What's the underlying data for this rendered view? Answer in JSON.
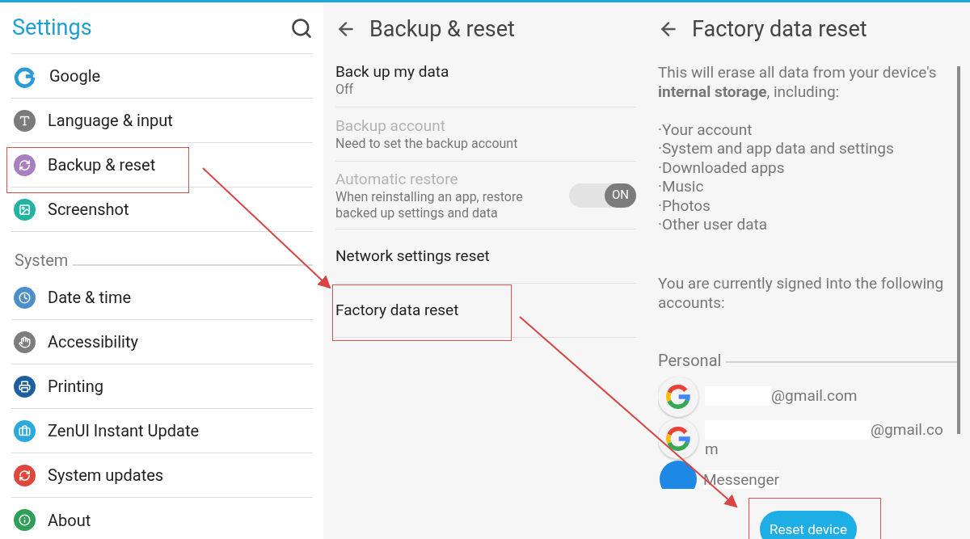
{
  "settings": {
    "title": "Settings",
    "sections": [
      {
        "items": [
          {
            "label": "Google"
          },
          {
            "label": "Language & input"
          },
          {
            "label": "Backup & reset"
          },
          {
            "label": "Screenshot"
          }
        ]
      },
      {
        "header": "System",
        "items": [
          {
            "label": "Date & time"
          },
          {
            "label": "Accessibility"
          },
          {
            "label": "Printing"
          },
          {
            "label": "ZenUI Instant Update"
          },
          {
            "label": "System updates"
          },
          {
            "label": "About"
          }
        ]
      }
    ]
  },
  "backup_reset": {
    "title": "Backup & reset",
    "items": [
      {
        "kind": "text",
        "title": "Back up my data",
        "subtitle": "Off",
        "disabled": false
      },
      {
        "kind": "text",
        "title": "Backup account",
        "subtitle": "Need to set the backup account",
        "disabled": true
      },
      {
        "kind": "toggle",
        "title": "Automatic restore",
        "subtitle": "When reinstalling an app, restore backed up settings and data",
        "disabled": true,
        "toggle_label": "ON",
        "on": true
      },
      {
        "kind": "text",
        "title": "Network settings reset",
        "disabled": false
      },
      {
        "kind": "text",
        "title": "Factory data reset",
        "disabled": false
      }
    ]
  },
  "factory_reset": {
    "title": "Factory data reset",
    "intro": "This will erase all data from your device's **internal storage**, including:",
    "erase_items": [
      "·Your account",
      "·System and app data and settings",
      "·Downloaded apps",
      "·Music",
      "·Photos",
      "·Other user data"
    ],
    "signed_in_text": "You are currently signed into the following accounts:",
    "accounts_header": "Personal",
    "accounts": [
      {
        "kind": "google",
        "text": "@gmail.com"
      },
      {
        "kind": "google",
        "text": "@gmail.com"
      },
      {
        "kind": "messenger",
        "text": "Messenger"
      }
    ],
    "button": "Reset device"
  }
}
